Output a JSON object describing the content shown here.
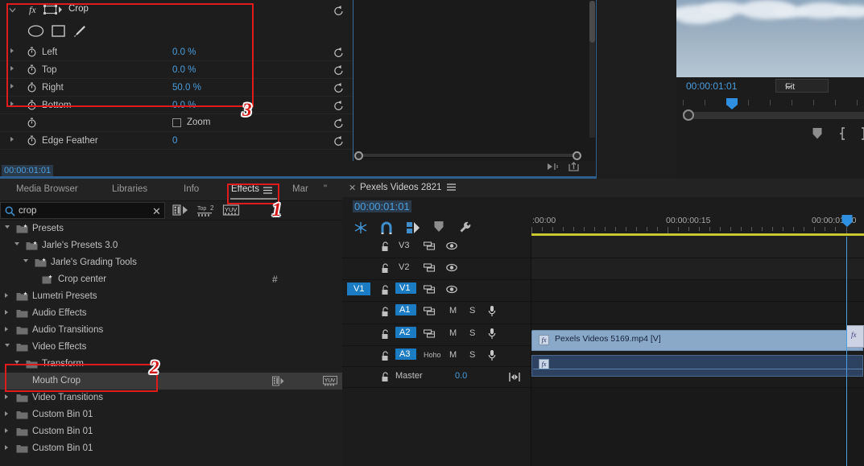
{
  "effect_controls": {
    "effect_name": "Crop",
    "fx_label": "fx",
    "properties": [
      {
        "label": "Left",
        "value": "0.0 %"
      },
      {
        "label": "Top",
        "value": "0.0 %"
      },
      {
        "label": "Right",
        "value": "50.0 %"
      },
      {
        "label": "Bottom",
        "value": "0.0 %"
      }
    ],
    "zoom_label": "Zoom",
    "zoom_checked": false,
    "edge_feather": {
      "label": "Edge Feather",
      "value": "0"
    },
    "timecode": "00:00:01:01"
  },
  "program_monitor": {
    "timecode": "00:00:01:01",
    "fit_label": "Fit"
  },
  "effects_panel": {
    "tabs": [
      {
        "label": "Media Browser",
        "active": false
      },
      {
        "label": "Libraries",
        "active": false
      },
      {
        "label": "Info",
        "active": false
      },
      {
        "label": "Effects",
        "active": true
      },
      {
        "label": "Mar",
        "active": false
      },
      {
        "label": "\"",
        "active": false
      }
    ],
    "search": {
      "value": "crop",
      "placeholder": "crop"
    },
    "tree": [
      {
        "label": "Presets",
        "indent": 0,
        "state": "open",
        "kind": "preset-folder"
      },
      {
        "label": "Jarle's Presets 3.0",
        "indent": 1,
        "state": "open",
        "kind": "preset-folder"
      },
      {
        "label": "Jarle's Grading Tools",
        "indent": 2,
        "state": "open",
        "kind": "preset-folder"
      },
      {
        "label": "Crop center",
        "indent": 3,
        "state": "leaf",
        "kind": "preset",
        "badge": "#"
      },
      {
        "label": "Lumetri Presets",
        "indent": 0,
        "state": "closed",
        "kind": "preset-folder"
      },
      {
        "label": "Audio Effects",
        "indent": 0,
        "state": "closed",
        "kind": "folder"
      },
      {
        "label": "Audio Transitions",
        "indent": 0,
        "state": "closed",
        "kind": "folder"
      },
      {
        "label": "Video Effects",
        "indent": 0,
        "state": "open",
        "kind": "folder"
      },
      {
        "label": "Transform",
        "indent": 1,
        "state": "open",
        "kind": "folder"
      },
      {
        "label": "Mouth Crop",
        "indent": 2,
        "state": "leaf",
        "kind": "effect",
        "selected": true,
        "icons": true
      },
      {
        "label": "Video Transitions",
        "indent": 0,
        "state": "closed",
        "kind": "folder"
      },
      {
        "label": "Custom Bin 01",
        "indent": 0,
        "state": "closed",
        "kind": "folder"
      },
      {
        "label": "Custom Bin 01",
        "indent": 0,
        "state": "closed",
        "kind": "folder"
      },
      {
        "label": "Custom Bin 01",
        "indent": 0,
        "state": "closed",
        "kind": "folder"
      }
    ]
  },
  "timeline": {
    "sequence_name": "Pexels Videos 2821",
    "timecode": "00:00:01:01",
    "ruler_labels": [
      ":00:00",
      "00:00:00:15",
      "00:00:01:00"
    ],
    "tracks": [
      {
        "name": "V3",
        "type": "video",
        "targeted": false,
        "sync_on": false
      },
      {
        "name": "V2",
        "type": "video",
        "targeted": false,
        "sync_on": false
      },
      {
        "name": "V1",
        "type": "video",
        "targeted": true,
        "sync_on": true,
        "source_patch": "V1"
      },
      {
        "name": "A1",
        "type": "audio",
        "targeted": true,
        "m": "M",
        "s": "S"
      },
      {
        "name": "A2",
        "type": "audio",
        "targeted": true,
        "m": "M",
        "s": "S"
      },
      {
        "name": "A3",
        "type": "audio",
        "targeted": true,
        "m": "M",
        "s": "S",
        "note": "Hoho"
      },
      {
        "name": "Master",
        "type": "master",
        "level": "0.0"
      }
    ],
    "clips": [
      {
        "track": "V1",
        "name": "Pexels Videos 5169.mp4 [V]"
      },
      {
        "track": "A1",
        "name": ""
      }
    ]
  },
  "annotations": [
    {
      "number": "1",
      "target": "effects-tab"
    },
    {
      "number": "2",
      "target": "transform-folder"
    },
    {
      "number": "3",
      "target": "crop-parameters"
    }
  ],
  "colors": {
    "accent_blue": "#4a9ede",
    "annotation_red": "#d31616",
    "clip_video": "#8aa8c8",
    "clip_audio": "#2c4260",
    "track_target": "#1b7cc4"
  }
}
